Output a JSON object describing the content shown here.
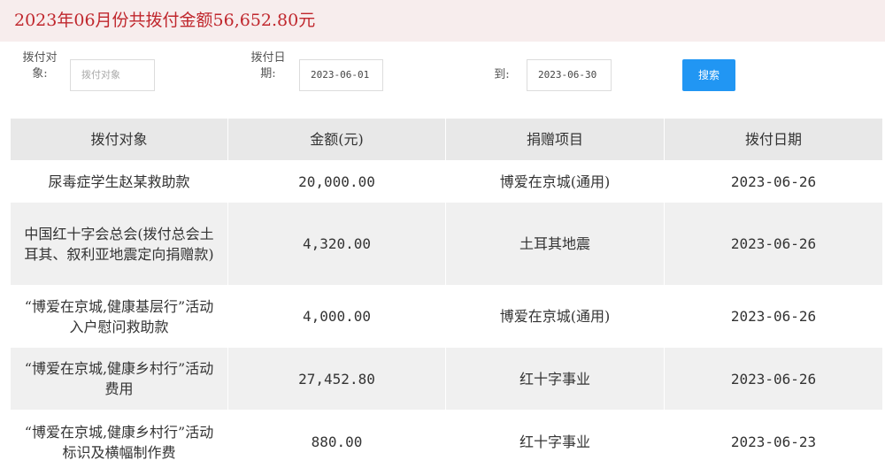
{
  "summary": "2023年06月份共拨付金额56,652.80元",
  "filters": {
    "object_label_l1": "拨付对",
    "object_label_l2": "象:",
    "object_placeholder": "拨付对象",
    "date_label_l1": "拨付日",
    "date_label_l2": "期:",
    "date_from": "2023-06-01",
    "to_label": "到:",
    "date_to": "2023-06-30",
    "search_label": "搜索"
  },
  "table": {
    "headers": [
      "拨付对象",
      "金额(元)",
      "捐赠项目",
      "拨付日期"
    ],
    "rows": [
      {
        "object": "尿毒症学生赵某救助款",
        "amount": "20,000.00",
        "project": "博爱在京城(通用)",
        "date": "2023-06-26"
      },
      {
        "object": "中国红十字会总会(拨付总会土耳其、叙利亚地震定向捐赠款)",
        "amount": "4,320.00",
        "project": "土耳其地震",
        "date": "2023-06-26"
      },
      {
        "object": "“博爱在京城,健康基层行”活动入户慰问救助款",
        "amount": "4,000.00",
        "project": "博爱在京城(通用)",
        "date": "2023-06-26"
      },
      {
        "object": "“博爱在京城,健康乡村行”活动费用",
        "amount": "27,452.80",
        "project": "红十字事业",
        "date": "2023-06-26"
      },
      {
        "object": "“博爱在京城,健康乡村行”活动标识及横幅制作费",
        "amount": "880.00",
        "project": "红十字事业",
        "date": "2023-06-23"
      }
    ]
  }
}
